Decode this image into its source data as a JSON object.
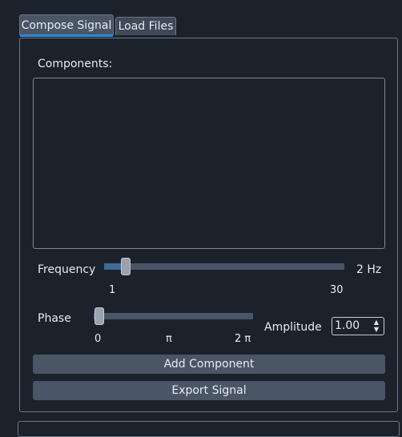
{
  "tabs": [
    {
      "label": "Compose Signal",
      "active": true
    },
    {
      "label": "Load Files",
      "active": false
    }
  ],
  "compose": {
    "components_label": "Components:",
    "components_items": [],
    "frequency": {
      "label": "Frequency",
      "min": 1,
      "max": 30,
      "value": 2,
      "min_label": "1",
      "max_label": "30",
      "value_label": "2 Hz"
    },
    "phase": {
      "label": "Phase",
      "ticks": [
        "0",
        "π",
        "2 π"
      ],
      "value_fraction": 0
    },
    "amplitude": {
      "label": "Amplitude",
      "value": "1.00"
    },
    "add_button": "Add Component",
    "export_button": "Export Signal"
  },
  "colors": {
    "background": "#1b222c",
    "accent": "#2f87d6",
    "button": "#4a5566",
    "slider_track": "#4a5668",
    "slider_fill": "#3f6b96"
  }
}
